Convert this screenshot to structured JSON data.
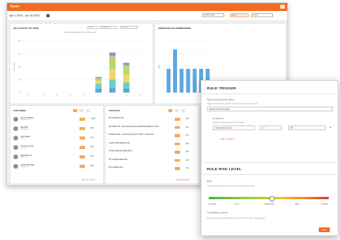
{
  "app": {
    "logo": "Egnyte",
    "date_range": "Apr 1 2019 - Jun 30 2019"
  },
  "header": {
    "filter_1": "Select Folder",
    "filter_2": "All",
    "user": "Admin",
    "filter_3": "Export"
  },
  "colors": {
    "brand": "#f26b21",
    "bar_blue": "#5aa8e0",
    "bar_green": "#b7d86a",
    "bar_yellow": "#f3d66b",
    "bar_teal": "#6fcfc3",
    "bar_purple": "#9b8fd6"
  },
  "charts": {
    "activity": {
      "title": "FILE ACTIVITY BY DATE",
      "controls": [
        "Users",
        "All Activities",
        "By Date"
      ],
      "legend": "Deleted  Uploaded  Moved  Renamed",
      "ylabel": "File Count"
    },
    "permissions": {
      "title": "SENSITIVE FILE PERMISSIONS",
      "ylabel": "Files"
    }
  },
  "chart_data": [
    {
      "type": "bar",
      "categories": [
        "1",
        "2",
        "3",
        "4",
        "5",
        "6",
        "7",
        "8",
        "9"
      ],
      "series": [
        {
          "values": [
            0,
            0,
            0,
            0,
            0,
            3,
            4,
            3,
            0
          ]
        },
        {
          "values": [
            0,
            0,
            0,
            0,
            0,
            4,
            6,
            5,
            0
          ]
        },
        {
          "values": [
            0,
            0,
            0,
            0,
            0,
            2,
            8,
            6,
            0
          ]
        },
        {
          "values": [
            0,
            0,
            0,
            0,
            0,
            2,
            10,
            7,
            0
          ]
        },
        {
          "values": [
            0,
            0,
            0,
            0,
            0,
            1,
            3,
            2,
            0
          ]
        }
      ],
      "ylim": [
        0,
        40
      ]
    },
    {
      "type": "bar",
      "categories": [
        "1",
        "2",
        "3",
        "4",
        "5",
        "6",
        "7"
      ],
      "values": [
        55,
        100,
        55,
        55,
        55,
        55,
        55
      ],
      "ylim": [
        0,
        120
      ]
    }
  ],
  "users_panel": {
    "title": "TOP USERS",
    "rows": [
      {
        "name": "James Wesley",
        "sub": "Engineering",
        "value": "1,284"
      },
      {
        "name": "Kay Bell",
        "sub": "Marketing",
        "value": "986"
      },
      {
        "name": "Josh Miles",
        "sub": "Sales",
        "value": "742"
      },
      {
        "name": "Thomas Lowe",
        "sub": "Support",
        "value": "533"
      },
      {
        "name": "Mark Barnes",
        "sub": "Finance",
        "value": "412"
      },
      {
        "name": "Carlos Mendez",
        "sub": "Operations",
        "value": "308"
      }
    ],
    "footer": "View All Users"
  },
  "files_panel": {
    "title": "TOP FILES",
    "rows": [
      {
        "name": "PII-checklist.xlsx",
        "value": "842"
      },
      {
        "name": "Q2-2019 US - 10 Lead sources published-alliance-docx",
        "value": "617"
      },
      {
        "name": "Federal Data - check Log-Q2-FY 2019 - Audit.xlsx",
        "value": "511"
      },
      {
        "name": "Credit Card Details.xlsx",
        "value": "406"
      },
      {
        "name": "CCVR Medical Stats.docx",
        "value": "322"
      },
      {
        "name": "PII-medical-data.xlsx",
        "value": "287"
      },
      {
        "name": "Tax-profiles.xlsx",
        "value": "201"
      }
    ],
    "footer": "View All Files"
  },
  "rule": {
    "trigger_title": "RULE TRIGGER",
    "trigger_label": "Select threshold identifiers",
    "trigger_help": "Select the action which the rule will be built upon",
    "trigger_select": "Documents created",
    "condition_label": "Conditions",
    "condition_help": "Select parameters for this rule",
    "cond_field": "Threshold count",
    "cond_op": ">=",
    "cond_value": "50",
    "add_condition": "Add Condition",
    "risk_title": "RULE RISK LEVEL",
    "risk_label": "Risk",
    "risk_help": "Select the degree of risk for violating this rule",
    "risk_levels": [
      "No Risk",
      "Low",
      "Moderate",
      "High",
      "Critical"
    ],
    "risk_value": 0.52,
    "notify_label": "Immediately Alerted",
    "notify_help": "Receive an email alert the moment this rule is triggered",
    "save": "Save"
  }
}
